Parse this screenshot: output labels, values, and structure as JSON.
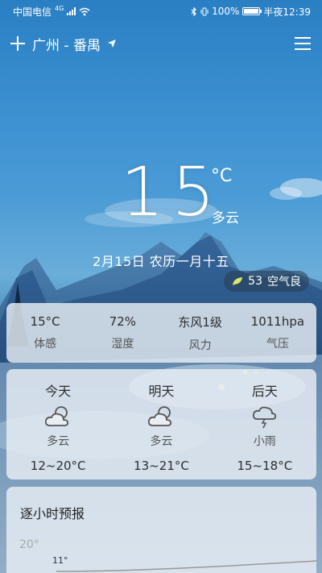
{
  "status_bar": {
    "carrier": "中国电信",
    "network": "4G",
    "battery": "100%",
    "time": "半夜12:39"
  },
  "header": {
    "location": "广州 - 番禺"
  },
  "current": {
    "temperature": "15",
    "unit": "°C",
    "condition": "多云",
    "date": "2月15日  农历一月十五",
    "aqi_value": "53",
    "aqi_label": "空气良"
  },
  "stats": [
    {
      "value": "15°C",
      "label": "体感"
    },
    {
      "value": "72%",
      "label": "湿度"
    },
    {
      "value": "东风1级",
      "label": "风力"
    },
    {
      "value": "1011hpa",
      "label": "气压"
    }
  ],
  "forecast": [
    {
      "day": "今天",
      "icon": "cloud-sun-icon",
      "condition": "多云",
      "range": "12~20°C"
    },
    {
      "day": "明天",
      "icon": "cloud-sun-icon",
      "condition": "多云",
      "range": "13~21°C"
    },
    {
      "day": "后天",
      "icon": "cloud-rain-icon",
      "condition": "小雨",
      "range": "15~18°C"
    }
  ],
  "hourly": {
    "title": "逐小时预报",
    "y_label": "20°",
    "point_label": "11°"
  },
  "colors": {
    "sky_top": "#2a7fc4",
    "mountains": "#2c5a85",
    "card_bg": "#e8eef4",
    "temp_text": "#ffffff"
  }
}
